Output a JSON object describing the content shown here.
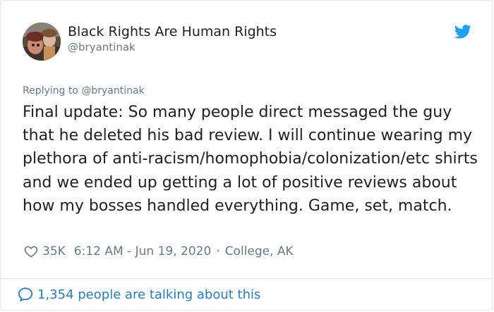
{
  "author": {
    "name": "Black Rights Are Human Rights",
    "handle": "@bryantinak"
  },
  "reply": {
    "text": "Replying to @bryantinak"
  },
  "tweet": {
    "text": "Final update: So many people direct messaged the guy that he deleted his bad review. I will continue wearing my plethora of anti-racism/homophobia/colonization/etc shirts and we ended up getting a lot of positive reviews about how my bosses handled everything. Game, set, match."
  },
  "meta": {
    "likes": "35K",
    "timestamp": "6:12 AM - Jun 19, 2020",
    "separator": "·",
    "location": "College, AK"
  },
  "footer": {
    "talking": "1,354 people are talking about this"
  },
  "colors": {
    "twitter_blue": "#1da1f2",
    "link_blue": "#2b7bb9",
    "secondary_gray": "#697882",
    "text": "#1c2022"
  },
  "icons": {
    "brand": "twitter-bird-icon",
    "like": "heart-icon",
    "talking": "speech-bubble-icon"
  }
}
